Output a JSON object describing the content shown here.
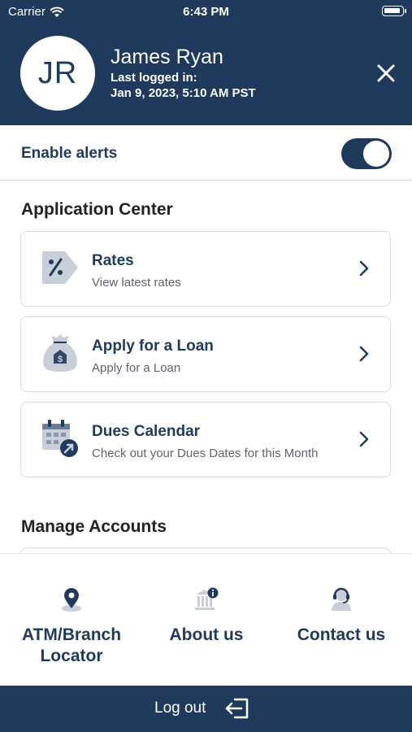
{
  "status_bar": {
    "carrier": "Carrier",
    "time": "6:43 PM"
  },
  "profile": {
    "initials": "JR",
    "name": "James Ryan",
    "last_login_label": "Last logged in:",
    "last_login_value": "Jan 9, 2023, 5:10 AM PST"
  },
  "alerts": {
    "label": "Enable alerts",
    "enabled": true
  },
  "application_center": {
    "title": "Application Center",
    "items": [
      {
        "title": "Rates",
        "subtitle": "View latest rates",
        "icon": "percent-tag-icon"
      },
      {
        "title": "Apply for a Loan",
        "subtitle": "Apply for a Loan",
        "icon": "money-bag-icon"
      },
      {
        "title": "Dues Calendar",
        "subtitle": "Check out your Dues Dates for this Month",
        "icon": "calendar-icon"
      }
    ]
  },
  "manage_accounts": {
    "title": "Manage Accounts"
  },
  "bottom_nav": {
    "items": [
      {
        "label_line1": "ATM/Branch",
        "label_line2": "Locator",
        "icon": "location-pin-icon"
      },
      {
        "label_line1": "About us",
        "label_line2": "",
        "icon": "bank-info-icon"
      },
      {
        "label_line1": "Contact us",
        "label_line2": "",
        "icon": "support-agent-icon"
      }
    ]
  },
  "logout": {
    "label": "Log out",
    "icon": "logout-icon"
  },
  "colors": {
    "primary": "#1f3a5c",
    "icon_fill": "#c8cfd9",
    "text_muted": "#5d6570"
  }
}
